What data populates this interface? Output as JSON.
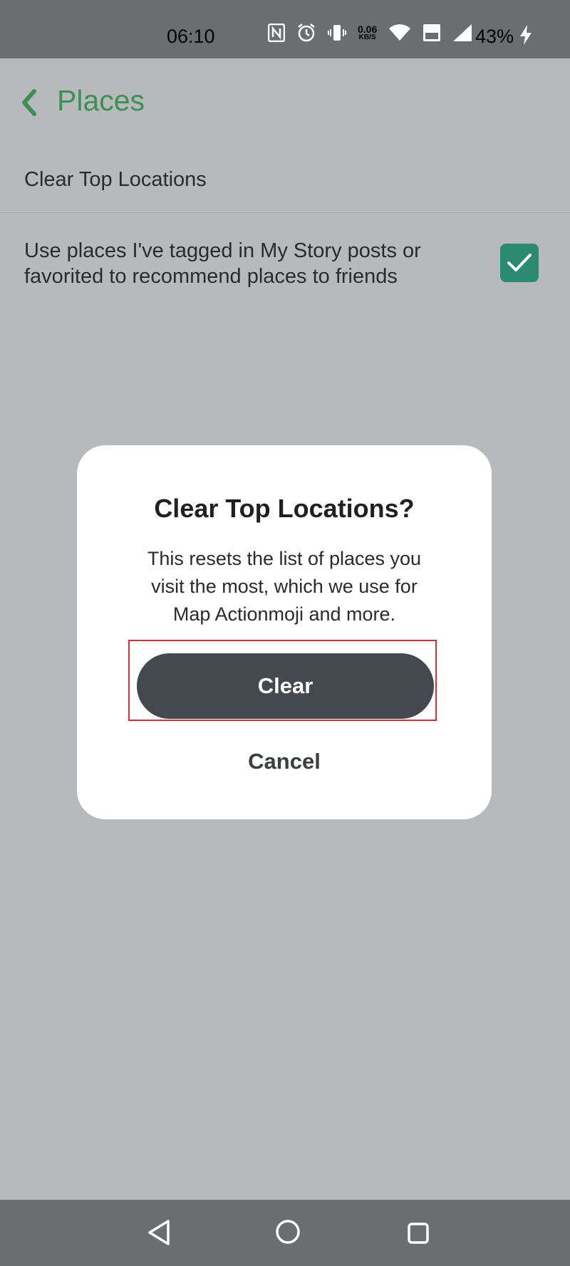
{
  "status_bar": {
    "time": "06:10",
    "net_speed_value": "0.06",
    "net_speed_unit": "KB/S",
    "battery": "43%",
    "icons": [
      "nfc-icon",
      "alarm-icon",
      "vibrate-icon",
      "wifi-icon",
      "volte-icon",
      "signal-icon",
      "charging-icon"
    ]
  },
  "header": {
    "title": "Places"
  },
  "settings": {
    "clear_top_locations": "Clear Top Locations",
    "use_places_line1": "Use places I've tagged in My Story posts or",
    "use_places_line2": "favorited to recommend places to friends",
    "use_places_checked": true
  },
  "dialog": {
    "title": "Clear Top Locations?",
    "body_line1": "This resets the list of places you",
    "body_line2": "visit the most, which we use for",
    "body_line3": "Map Actionmoji and more.",
    "clear_label": "Clear",
    "cancel_label": "Cancel"
  },
  "colors": {
    "accent_green": "#3d9051",
    "checkbox_teal": "#2a8a72",
    "highlight_red": "#c8323a",
    "button_dark": "#444950"
  }
}
